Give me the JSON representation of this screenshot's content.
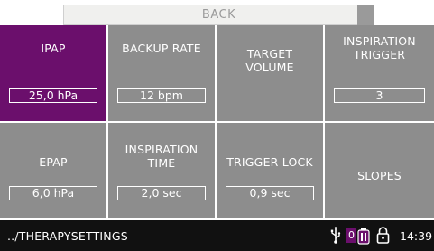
{
  "back_button": {
    "label": "BACK"
  },
  "tiles": [
    {
      "name": "IPAP",
      "value": "25,0 hPa",
      "selected": true
    },
    {
      "name": "BACKUP RATE",
      "value": "12 bpm"
    },
    {
      "name": "TARGET\nVOLUME",
      "value": ""
    },
    {
      "name": "INSPIRATION\nTRIGGER",
      "value": "3"
    },
    {
      "name": "EPAP",
      "value": "6,0 hPa"
    },
    {
      "name": "INSPIRATION\nTIME",
      "value": "2,0 sec"
    },
    {
      "name": "TRIGGER LOCK",
      "value": "0,9 sec"
    },
    {
      "name": "SLOPES",
      "value": ""
    }
  ],
  "status_bar": {
    "path": "../THERAPYSETTINGS",
    "battery_label": "0",
    "time": "14:39",
    "icons": [
      "usb-icon",
      "battery-icon",
      "lock-icon"
    ]
  },
  "colors": {
    "selected": "#6b0f6c",
    "tile": "#8d8d8d",
    "status_bg": "#111111"
  }
}
